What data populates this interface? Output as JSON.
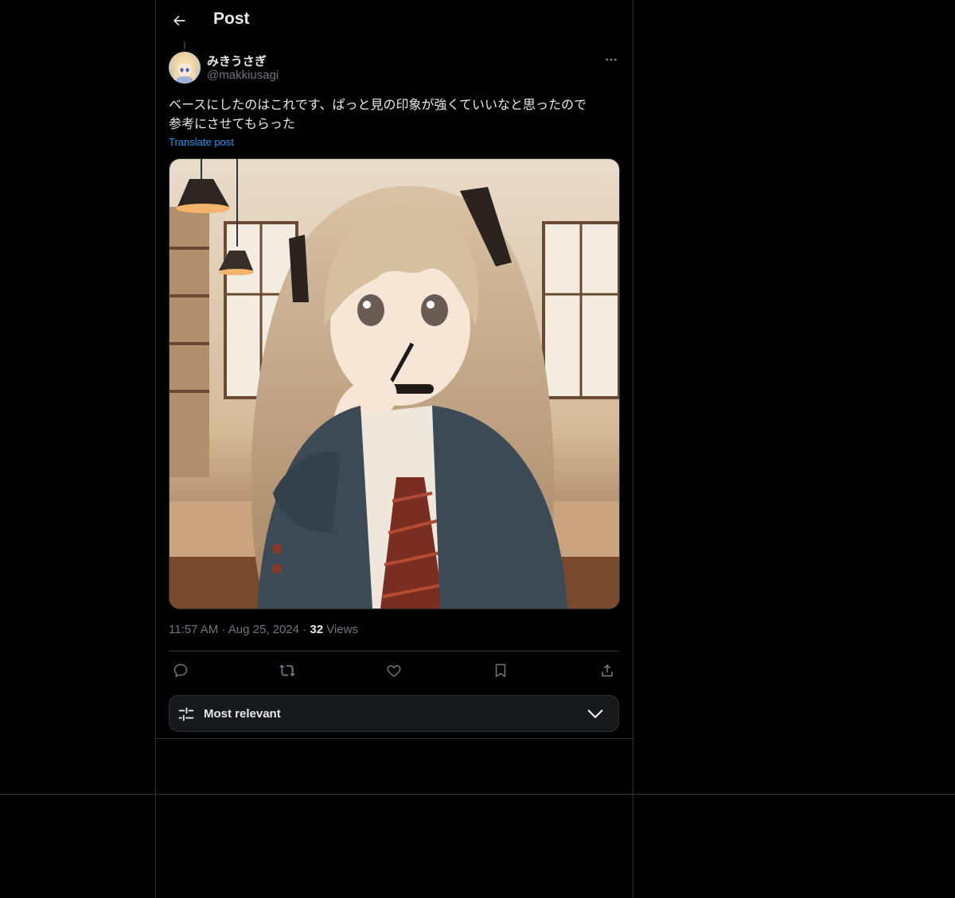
{
  "header": {
    "title": "Post",
    "back_icon": "arrow-left-icon"
  },
  "post": {
    "author": {
      "display_name": "みきうさぎ",
      "handle": "@makkiusagi"
    },
    "text_line1": "ベースにしたのはこれです、ぱっと見の印象が強くていいなと思ったので",
    "text_line2": "参考にさせてもらった",
    "translate_label": "Translate post",
    "time": "11:57 AM",
    "date": "Aug 25, 2024",
    "separator": "·",
    "views_count": "32",
    "views_label": "Views"
  },
  "actions": [
    {
      "name": "reply",
      "icon": "reply-icon"
    },
    {
      "name": "repost",
      "icon": "repost-icon"
    },
    {
      "name": "like",
      "icon": "heart-icon"
    },
    {
      "name": "bookmark",
      "icon": "bookmark-icon"
    },
    {
      "name": "share",
      "icon": "share-icon"
    }
  ],
  "sort": {
    "label": "Most relevant",
    "icon": "sliders-icon"
  },
  "colors": {
    "background": "#000000",
    "text_primary": "#e7e9ea",
    "text_secondary": "#71767b",
    "accent": "#1d9bf0",
    "border": "#2f3336"
  }
}
